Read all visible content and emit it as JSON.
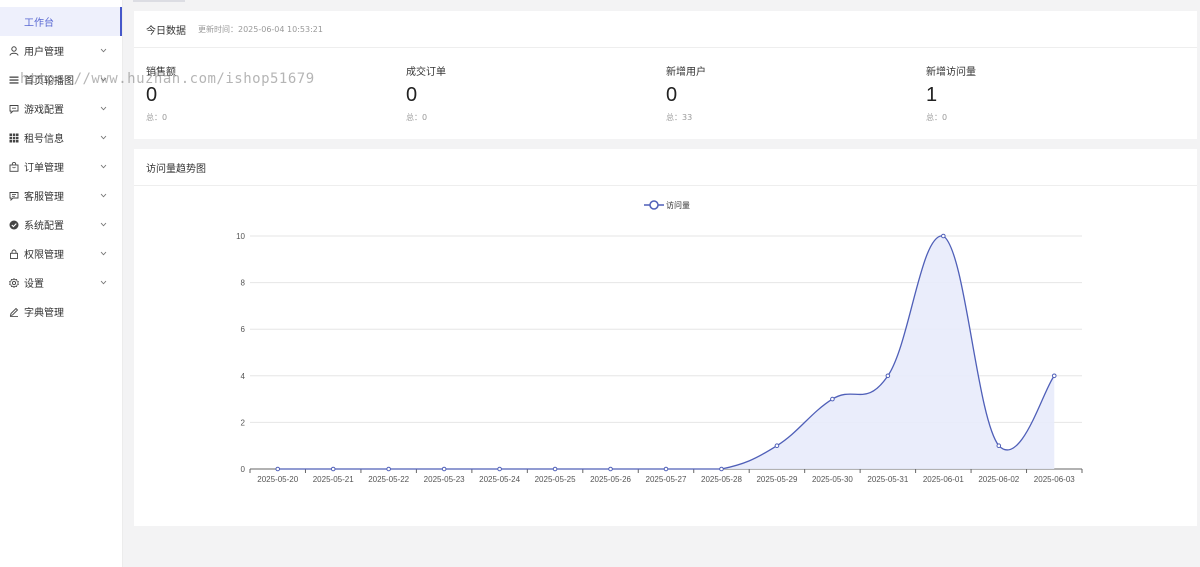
{
  "sidebar": {
    "active": {
      "label": "工作台"
    },
    "items": [
      {
        "label": "用户管理",
        "icon": "user-icon",
        "has_children": true
      },
      {
        "label": "首页轮播图",
        "icon": "list-icon",
        "has_children": true
      },
      {
        "label": "游戏配置",
        "icon": "message-icon",
        "has_children": true
      },
      {
        "label": "租号信息",
        "icon": "grid-icon",
        "has_children": true
      },
      {
        "label": "订单管理",
        "icon": "bag-icon",
        "has_children": true
      },
      {
        "label": "客服管理",
        "icon": "chat-icon",
        "has_children": true
      },
      {
        "label": "系统配置",
        "icon": "check-circle-icon",
        "has_children": true
      },
      {
        "label": "权限管理",
        "icon": "lock-icon",
        "has_children": true
      },
      {
        "label": "设置",
        "icon": "gear-icon",
        "has_children": true
      },
      {
        "label": "字典管理",
        "icon": "edit-icon",
        "has_children": false
      }
    ]
  },
  "today": {
    "title": "今日数据",
    "updated": "更新时间：2025-06-04 10:53:21",
    "stats": [
      {
        "label": "销售额",
        "value": "0",
        "total": "总：0"
      },
      {
        "label": "成交订单",
        "value": "0",
        "total": "总：0"
      },
      {
        "label": "新增用户",
        "value": "0",
        "total": "总：33"
      },
      {
        "label": "新增访问量",
        "value": "1",
        "total": "总：0"
      }
    ]
  },
  "trend": {
    "title": "访问量趋势图"
  },
  "watermark": "https://www.huzhan.com/ishop51679",
  "colors": {
    "accent": "#4658c9",
    "line": "#4f5fb8",
    "area": "#e8ebfb"
  },
  "chart_data": {
    "type": "area",
    "categories": [
      "2025-05-20",
      "2025-05-21",
      "2025-05-22",
      "2025-05-23",
      "2025-05-24",
      "2025-05-25",
      "2025-05-26",
      "2025-05-27",
      "2025-05-28",
      "2025-05-29",
      "2025-05-30",
      "2025-05-31",
      "2025-06-01",
      "2025-06-02",
      "2025-06-03"
    ],
    "series": [
      {
        "name": "访问量",
        "values": [
          0,
          0,
          0,
          0,
          0,
          0,
          0,
          0,
          0,
          1,
          3,
          4,
          10,
          1,
          4
        ]
      }
    ],
    "yticks": [
      0,
      2,
      4,
      6,
      8,
      10
    ],
    "ylim": [
      0,
      10
    ],
    "grid": true,
    "legend": "top-center",
    "smooth": true
  }
}
